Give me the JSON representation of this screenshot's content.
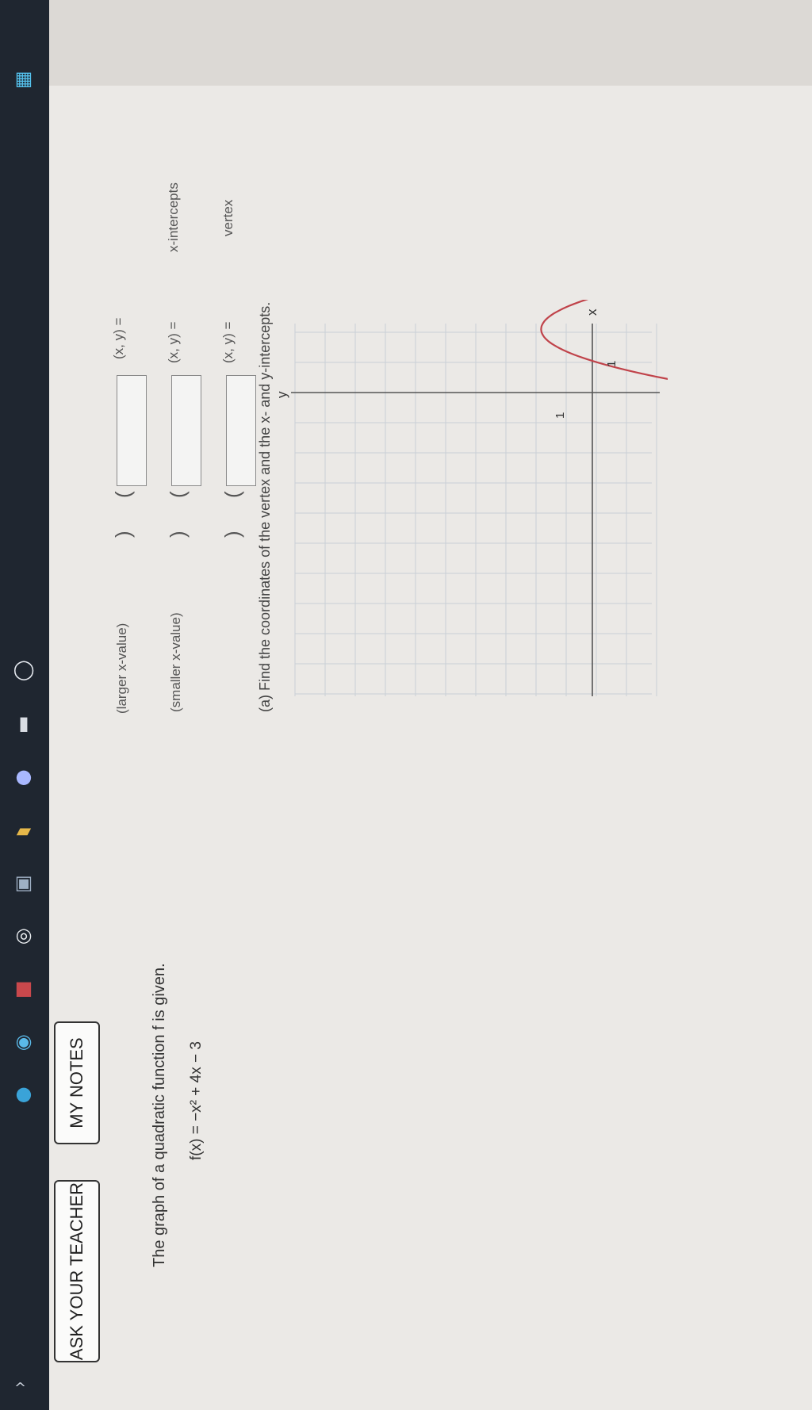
{
  "header": {
    "ask_teacher": "ASK YOUR TEACHER",
    "my_notes": "MY NOTES"
  },
  "problem": {
    "intro": "The graph of a quadratic function f is given.",
    "function": "f(x) = −x² + 4x − 3"
  },
  "graph": {
    "x_axis_label": "x",
    "y_axis_label": "y",
    "x_tick_label": "1",
    "y_tick_label": "1",
    "curve_color": "#c0434a"
  },
  "part_a": {
    "prompt": "(a) Find the coordinates of the vertex and the x- and y-intercepts.",
    "vertex_label": "vertex",
    "x_intercepts_label": "x-intercepts",
    "xy_label": "(x, y) =",
    "smaller_note": "(smaller x-value)",
    "larger_note": "(larger x-value)",
    "open_paren": "(",
    "close_paren": ")",
    "vertex_value": "",
    "x_intercept_smaller_value": "",
    "x_intercept_larger_value": ""
  },
  "taskbar": {
    "icons": [
      "grid-icon",
      "search-circle-icon",
      "file-icon",
      "media-icon",
      "folder-icon",
      "calendar-icon",
      "chrome-icon",
      "app-icon",
      "help-icon",
      "edge-icon"
    ]
  }
}
